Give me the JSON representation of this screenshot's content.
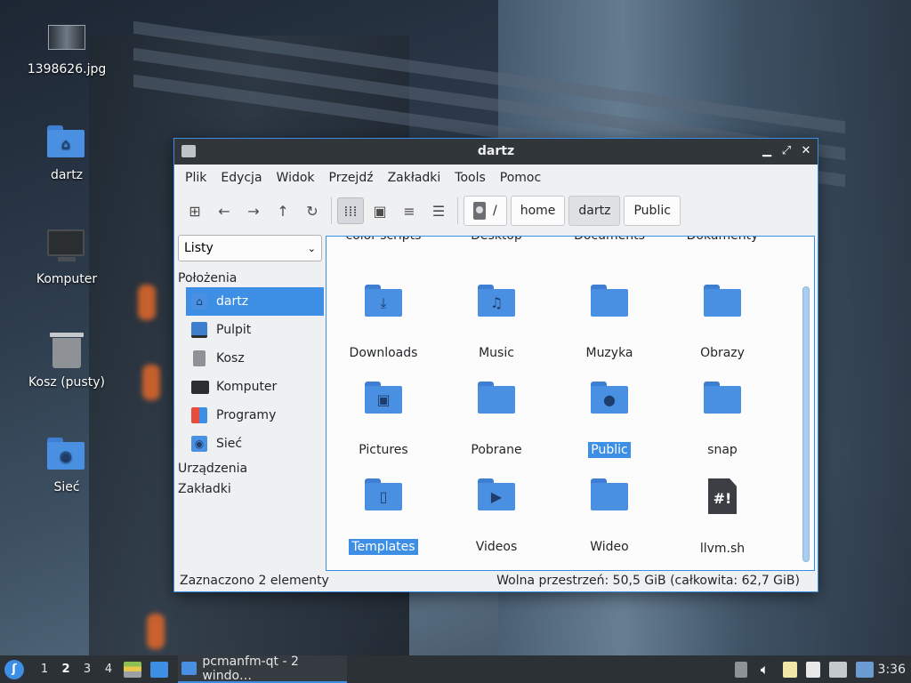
{
  "desktop": {
    "icons": [
      {
        "label": "1398626.jpg",
        "icon": "image-thumbnail-icon"
      },
      {
        "label": "dartz",
        "icon": "home-folder-icon"
      },
      {
        "label": "Komputer",
        "icon": "computer-icon"
      },
      {
        "label": "Kosz (pusty)",
        "icon": "trash-icon"
      },
      {
        "label": "Sieć",
        "icon": "network-folder-icon"
      }
    ]
  },
  "window": {
    "title": "dartz",
    "menu": [
      "Plik",
      "Edycja",
      "Widok",
      "Przejdź",
      "Zakładki",
      "Tools",
      "Pomoc"
    ],
    "breadcrumb": [
      "/",
      "home",
      "dartz",
      "Public"
    ],
    "side": {
      "view_select": "Listy",
      "places_heading": "Położenia",
      "places": [
        {
          "label": "dartz",
          "icon": "home-icon",
          "selected": true
        },
        {
          "label": "Pulpit",
          "icon": "desktop-icon",
          "selected": false
        },
        {
          "label": "Kosz",
          "icon": "trash-icon",
          "selected": false
        },
        {
          "label": "Komputer",
          "icon": "computer-icon",
          "selected": false
        },
        {
          "label": "Programy",
          "icon": "applications-icon",
          "selected": false
        },
        {
          "label": "Sieć",
          "icon": "network-icon",
          "selected": false
        }
      ],
      "devices_heading": "Urządzenia",
      "bookmarks_heading": "Zakładki"
    },
    "files_partial": [
      "color-scripts",
      "Desktop",
      "Documents",
      "Dokumenty"
    ],
    "files": [
      {
        "name": "Downloads",
        "emblem": "⤓",
        "selected": false,
        "type": "folder"
      },
      {
        "name": "Music",
        "emblem": "♫",
        "selected": false,
        "type": "folder"
      },
      {
        "name": "Muzyka",
        "emblem": "",
        "selected": false,
        "type": "folder"
      },
      {
        "name": "Obrazy",
        "emblem": "",
        "selected": false,
        "type": "folder"
      },
      {
        "name": "Pictures",
        "emblem": "▣",
        "selected": false,
        "type": "folder"
      },
      {
        "name": "Pobrane",
        "emblem": "",
        "selected": false,
        "type": "folder"
      },
      {
        "name": "Public",
        "emblem": "●",
        "selected": true,
        "type": "folder"
      },
      {
        "name": "snap",
        "emblem": "",
        "selected": false,
        "type": "folder"
      },
      {
        "name": "Templates",
        "emblem": "▯",
        "selected": true,
        "type": "folder"
      },
      {
        "name": "Videos",
        "emblem": "▶",
        "selected": false,
        "type": "folder"
      },
      {
        "name": "Wideo",
        "emblem": "",
        "selected": false,
        "type": "folder"
      },
      {
        "name": "llvm.sh",
        "emblem": "#!",
        "selected": false,
        "type": "script"
      }
    ],
    "status_left": "Zaznaczono 2 elementy",
    "status_right": "Wolna przestrzeń: 50,5 GiB (całkowita: 62,7 GiB)"
  },
  "taskbar": {
    "workspaces": [
      "1",
      "2",
      "3",
      "4"
    ],
    "active_workspace": "2",
    "task_label": "pcmanfm-qt - 2 windo…",
    "clock": "3:36"
  },
  "colors": {
    "accent": "#3d8ee5",
    "folder": "#4a90e2",
    "titlebar": "#31363b",
    "taskbar": "#2c3136"
  }
}
